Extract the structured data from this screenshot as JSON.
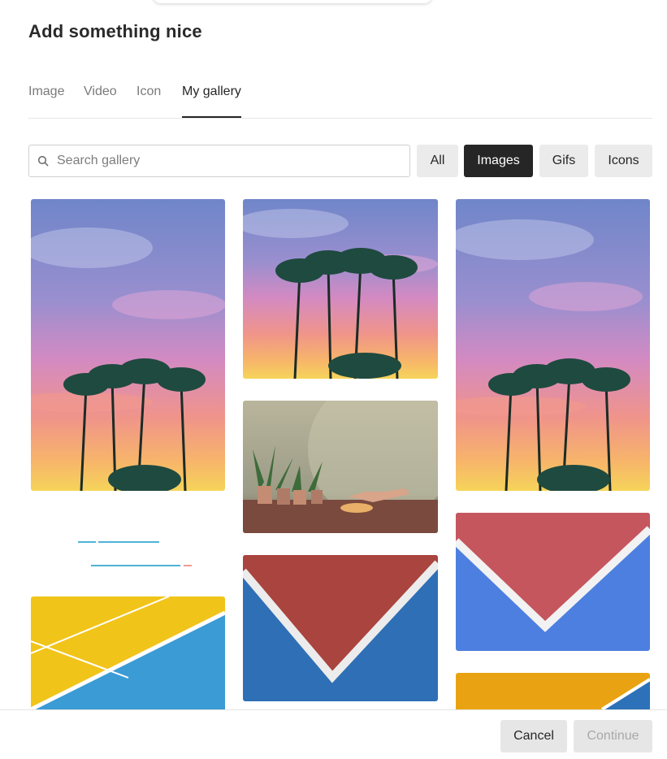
{
  "dialog": {
    "title": "Add something nice"
  },
  "tabs": [
    {
      "label": "Image",
      "active": false
    },
    {
      "label": "Video",
      "active": false
    },
    {
      "label": "Icon",
      "active": false
    },
    {
      "label": "My gallery",
      "active": true
    }
  ],
  "search": {
    "placeholder": "Search gallery",
    "value": "",
    "icon": "search-icon"
  },
  "filters": [
    {
      "label": "All",
      "active": false
    },
    {
      "label": "Images",
      "active": true
    },
    {
      "label": "Gifs",
      "active": false
    },
    {
      "label": "Icons",
      "active": false
    }
  ],
  "gallery": {
    "items": [
      {
        "kind": "palm-sunset"
      },
      {
        "kind": "palm-sunset"
      },
      {
        "kind": "palm-sunset"
      },
      {
        "kind": "loading-animation"
      },
      {
        "kind": "plants-still-life"
      },
      {
        "kind": "court-red-blue"
      },
      {
        "kind": "court-yellow-blue"
      },
      {
        "kind": "court-red-blue"
      },
      {
        "kind": "court-orange-blue"
      }
    ]
  },
  "footer": {
    "cancel_label": "Cancel",
    "continue_label": "Continue",
    "continue_disabled": true
  },
  "colors": {
    "accent_dark": "#262626",
    "button_gray": "#ebebeb",
    "loader_blue": "#4fb3d9",
    "loader_pink": "#ef9a9a"
  }
}
